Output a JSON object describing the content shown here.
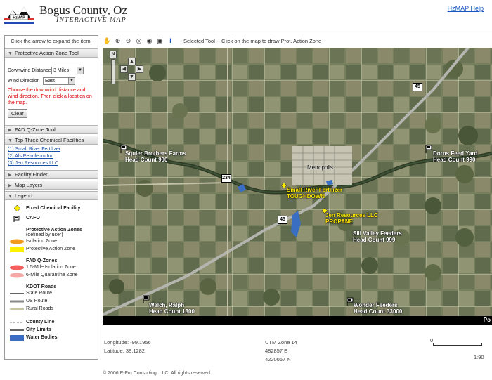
{
  "header": {
    "logo_text": "HzMAP",
    "title": "Bogus County, Oz",
    "subtitle": "INTERACTIVE MAP",
    "help_link": "HzMAP Help"
  },
  "left_panel": {
    "hint": "Click the arrow to expand the item.",
    "pa_zone_tool": {
      "title": "Protective Action Zone Tool",
      "downwind_label": "Downwind Distance",
      "downwind_value": "3 Miles",
      "wind_label": "Wind Direction",
      "wind_value": "East",
      "instructions": "Choose the downwind distance and wind direction. Then click a location on the map.",
      "clear_button": "Clear"
    },
    "fad_tool": {
      "title": "FAD Q-Zone Tool"
    },
    "top_facilities": {
      "title": "Top Three Chemical Facilities",
      "items": [
        "(1) Small River Fertilizer",
        "(2) Als Petroleum Inc",
        "(3) Jen Resources LLC"
      ]
    },
    "facility_finder": {
      "title": "Facility Finder"
    },
    "map_layers": {
      "title": "Map Layers"
    },
    "legend": {
      "title": "Legend",
      "fixed_facility": "Fixed Chemical Facility",
      "cafo": "CAFO",
      "pa_zones_title": "Protective Action Zones",
      "pa_zones_sub": "(defined by user)",
      "isolation_zone": "Isolation Zone",
      "protective_zone": "Protective Action Zone",
      "fad_title": "FAD Q-Zones",
      "fad_isolation": "1.5-Mile Isolation Zone",
      "fad_quarantine": "6-Mile Quarantine Zone",
      "kdot_title": "KDOT Roads",
      "state_route": "State Route",
      "us_route": "US Route",
      "rural_roads": "Rural Roads",
      "county_line": "County Line",
      "city_limits": "City Limits",
      "water_bodies": "Water Bodies"
    }
  },
  "toolbar": {
    "status": "Selected Tool -- Click on the map to draw Prot. Action Zone"
  },
  "map": {
    "labels": {
      "squier_name": "Squier Brothers Farms",
      "squier_head": "Head Count 900",
      "dorns_name": "Dorns Feed Yard",
      "dorns_head": "Head Count 990",
      "metropolis": "Metropolis",
      "small_river": "Small River Fertilizer",
      "small_river_sub": "TOUGHDOWN",
      "jen_resources": "Jen Resources LLC",
      "jen_sub": "PROPANE",
      "sill_name": "Sill Valley Feeders",
      "sill_head": "Head Count 999",
      "welch_name": "Welch, Ralph",
      "welch_head": "Head Count 1300",
      "wonder_name": "Wonder Feeders",
      "wonder_head": "Head Count 33000"
    },
    "shields": {
      "hwy_45_top": "45",
      "hwy_234": "234",
      "hwy_45_mid": "45"
    },
    "scale_edge": "Po"
  },
  "status_bar": {
    "longitude": "Longitude: -99.1956",
    "latitude": "Latitude: 38.1282",
    "utm_zone": "UTM Zone 14",
    "easting": "482857 E",
    "northing": "4220057 N",
    "scale_zero": "0",
    "scale_ratio": "1:90"
  },
  "footer": "© 2006 E-Fm Consulting, LLC. All rights reserved.",
  "colors": {
    "isolation_zone": "#f29a1c",
    "protective_zone": "#ffee00",
    "fad_isolation": "#f26060",
    "fad_quarantine": "#f5a8a8",
    "water": "#3a6ec2"
  }
}
